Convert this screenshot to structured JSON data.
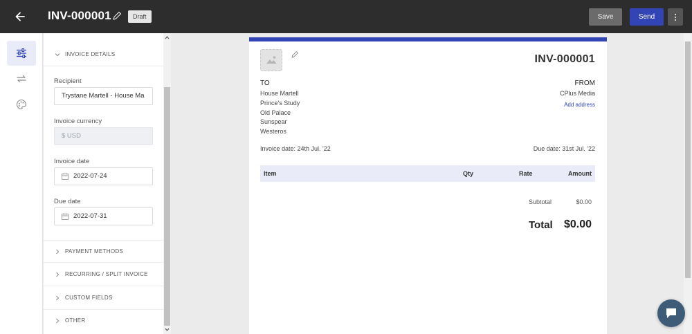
{
  "header": {
    "invoice_id": "INV-000001",
    "status_badge": "Draft",
    "save_label": "Save",
    "send_label": "Send",
    "accent_color": "#3344b5"
  },
  "rail": {
    "items": [
      {
        "icon": "sliders-icon",
        "active": true
      },
      {
        "icon": "repeat-icon",
        "active": false
      },
      {
        "icon": "palette-icon",
        "active": false
      }
    ]
  },
  "panel": {
    "section_open": "INVOICE DETAILS",
    "recipient_label": "Recipient",
    "recipient_value": "Trystane Martell - House Ma",
    "currency_label": "Invoice currency",
    "currency_value": "$ USD",
    "invoice_date_label": "Invoice date",
    "invoice_date_value": "2022-07-24",
    "due_date_label": "Due date",
    "due_date_value": "2022-07-31",
    "collapsed_sections": [
      "PAYMENT METHODS",
      "RECURRING / SPLIT INVOICE",
      "CUSTOM FIELDS",
      "OTHER"
    ]
  },
  "preview": {
    "invoice_number": "INV-000001",
    "to_label": "TO",
    "to_address": [
      "House Martell",
      "Prince's Study",
      "Old Palace",
      "Sunspear",
      "Westeros"
    ],
    "from_label": "FROM",
    "from_name": "CPlus Media",
    "add_address": "Add address",
    "invoice_date": "Invoice date: 24th Jul. '22",
    "due_date": "Due date: 31st Jul. '22",
    "columns": [
      "Item",
      "Qty",
      "Rate",
      "Amount"
    ],
    "subtotal_label": "Subtotal",
    "subtotal_value": "$0.00",
    "total_label": "Total",
    "total_value": "$0.00"
  }
}
